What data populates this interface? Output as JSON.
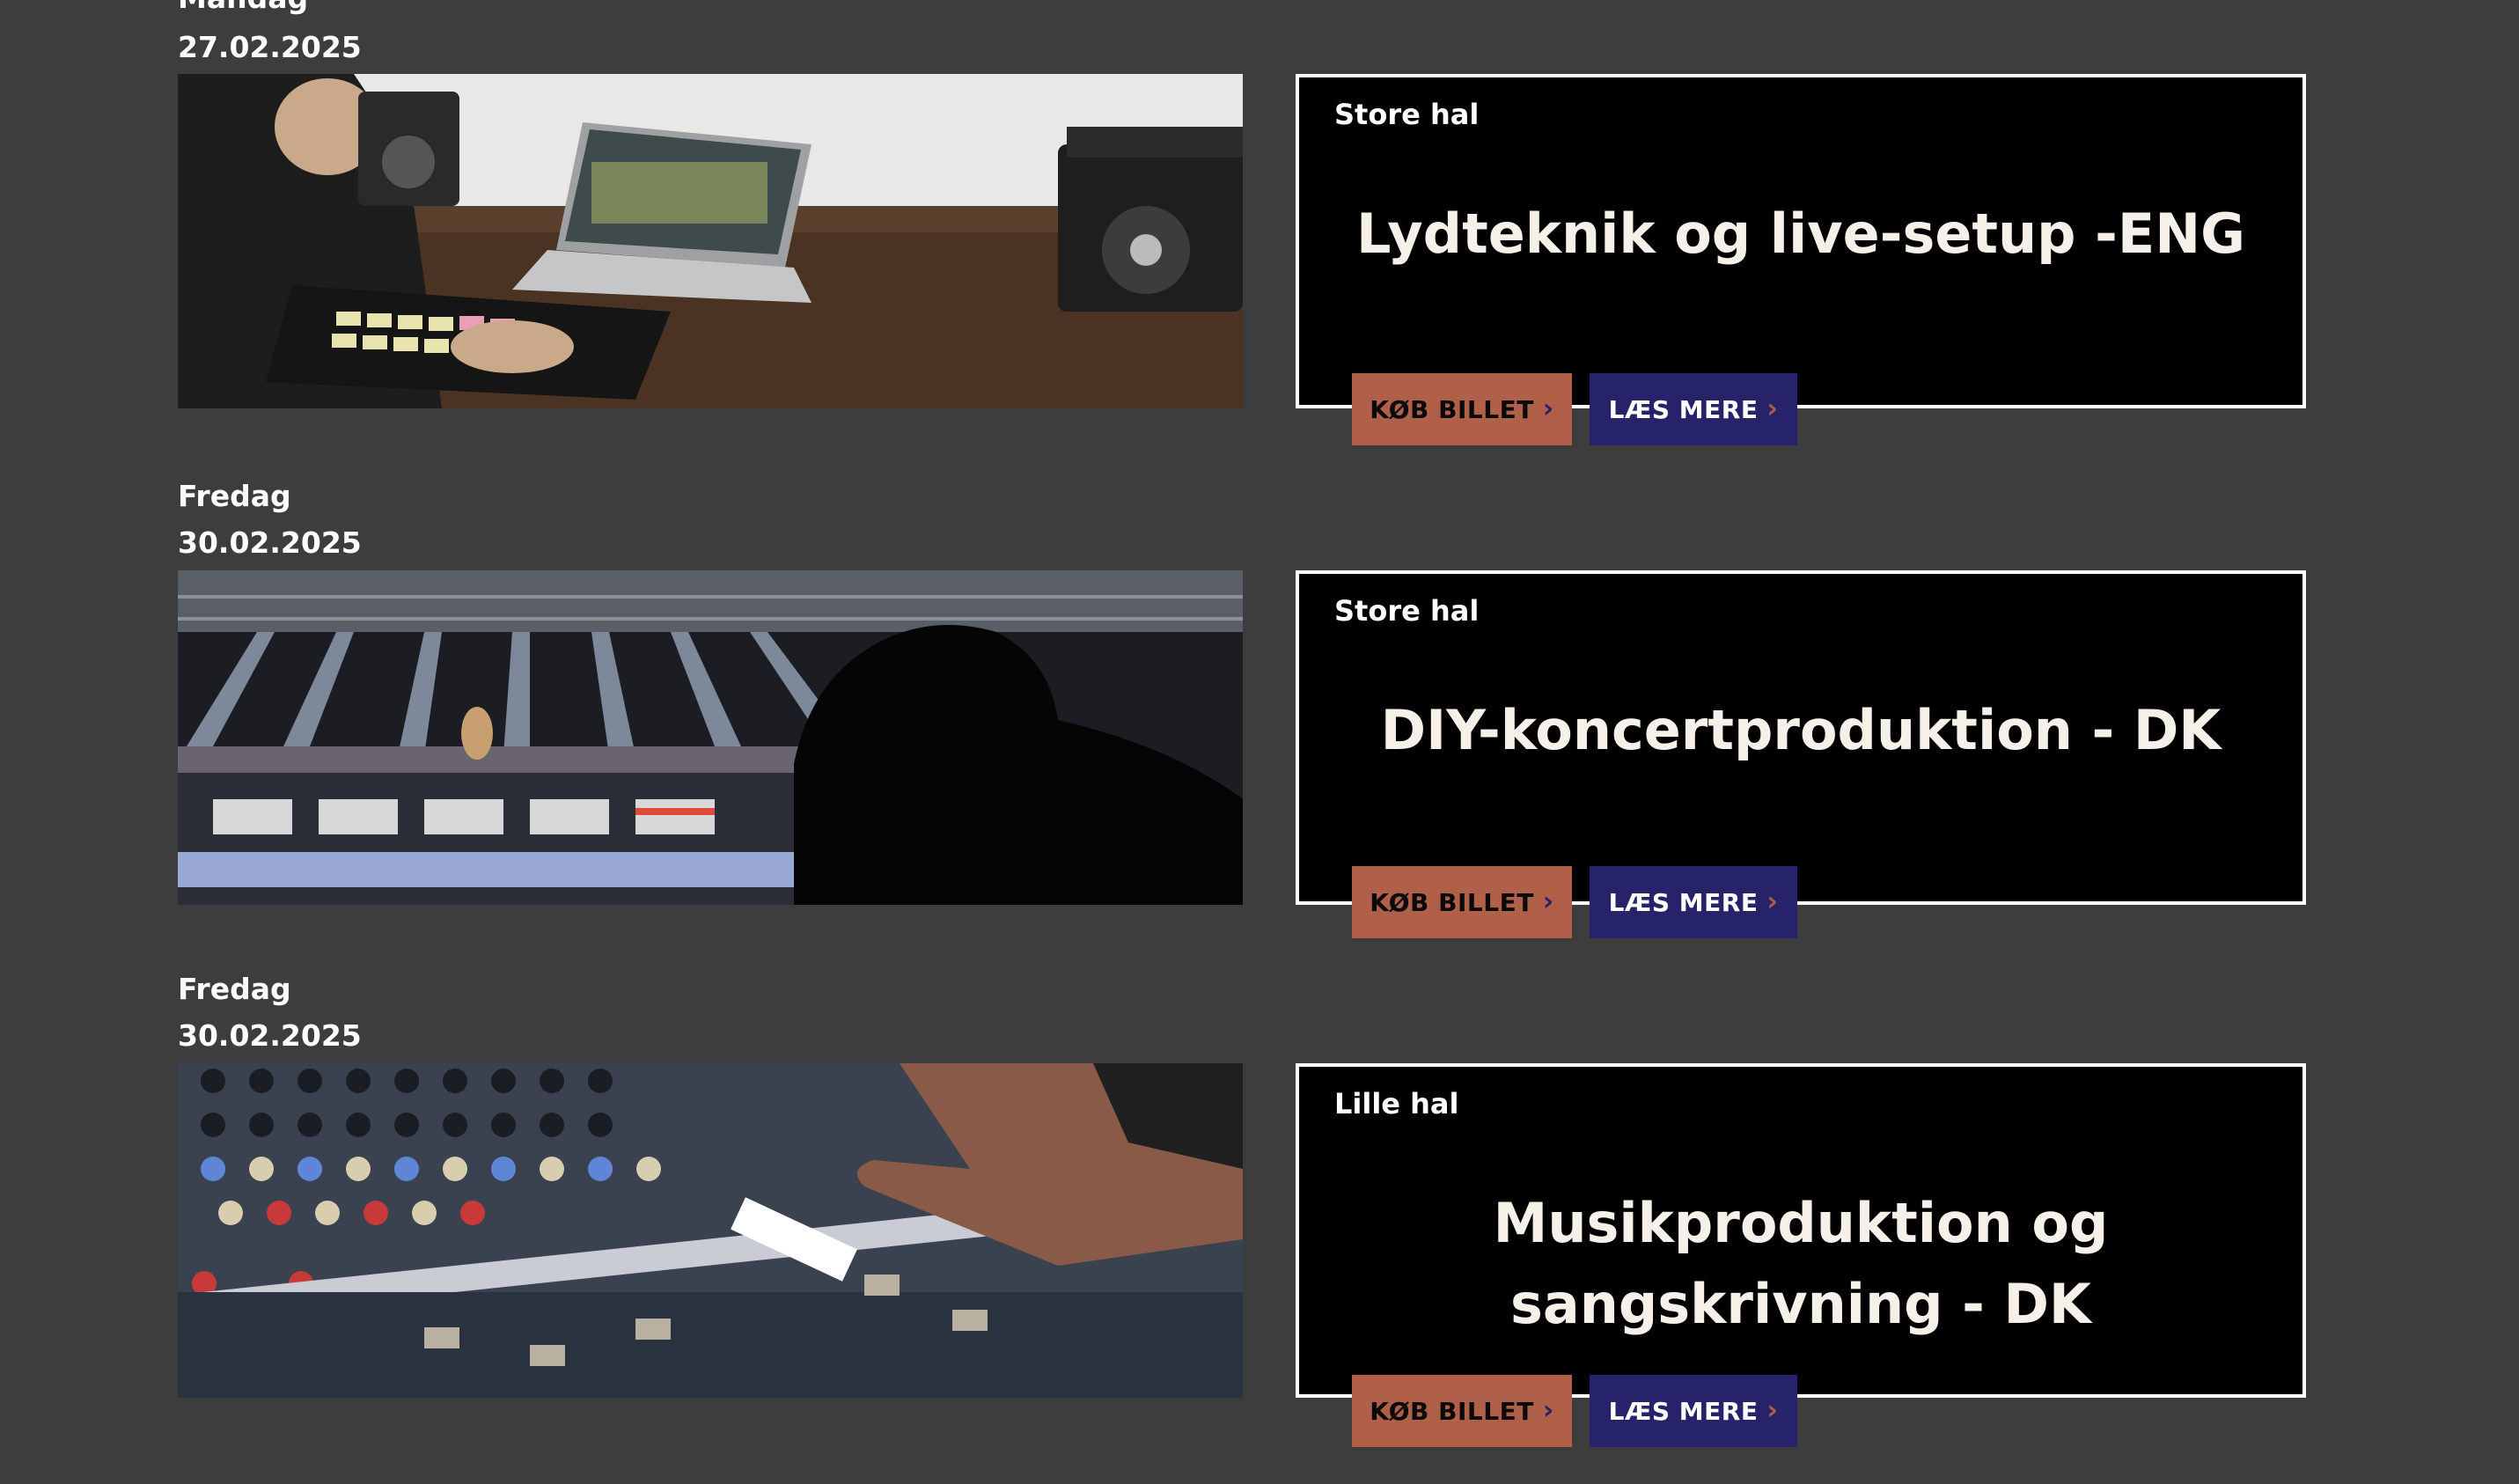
{
  "events": [
    {
      "day": "Mandag",
      "date": "27.02.2025",
      "hall": "Store hal",
      "title": "Lydteknik og live-setup -ENG",
      "buy_label": "KØB BILLET",
      "more_label": "LÆS MERE",
      "image": "laptop-and-pad-controller-photo"
    },
    {
      "day": "Fredag",
      "date": "30.02.2025",
      "hall": "Store hal",
      "title": "DIY-koncertproduktion - DK",
      "buy_label": "KØB BILLET",
      "more_label": "LÆS MERE",
      "image": "concert-mixing-desk-photo"
    },
    {
      "day": "Fredag",
      "date": "30.02.2025",
      "hall": "Lille hal",
      "title": "Musikproduktion og sangskrivning - DK",
      "buy_label": "KØB BILLET",
      "more_label": "LÆS MERE",
      "image": "mixing-console-faders-photo"
    }
  ],
  "icons": {
    "button_chevron": "chevron-right-icon"
  },
  "colors": {
    "page_background": "#3d3d3d",
    "card_background": "#000000",
    "card_border": "#ffffff",
    "buy_button": "#b05f48",
    "more_button": "#26236a"
  }
}
